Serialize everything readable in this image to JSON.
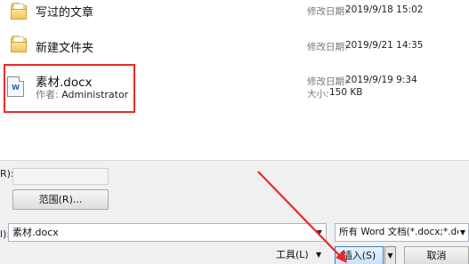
{
  "files": [
    {
      "type": "folder",
      "name": "写过的文章",
      "meta_label": "修改日期:",
      "meta_value": "2019/9/18 15:02"
    },
    {
      "type": "folder",
      "name": "新建文件夹",
      "meta_label": "修改日期:",
      "meta_value": "2019/9/21 14:35"
    },
    {
      "type": "docx",
      "name": "素材.docx",
      "author_label": "作者:",
      "author_value": "Administrator",
      "meta_label": "修改日期:",
      "meta_value": "2019/9/19 9:34",
      "size_label": "大小:",
      "size_value": "150 KB"
    }
  ],
  "bottom": {
    "cut_label_top": "R):",
    "range_button": "范围(R)...",
    "cut_label_filename": "l):",
    "filename_value": "素材.docx",
    "filter_value": "所有 Word 文档(*.docx;*.docx",
    "tools_label": "工具(L)",
    "insert_label": "插入(S)",
    "cancel_label": "取消"
  },
  "colors": {
    "highlight": "#e8282b",
    "insert_button_border": "#3c7fb1"
  },
  "icons": {
    "folder": "folder-icon",
    "document": "word-document-icon",
    "dropdown": "chevron-down-icon"
  }
}
